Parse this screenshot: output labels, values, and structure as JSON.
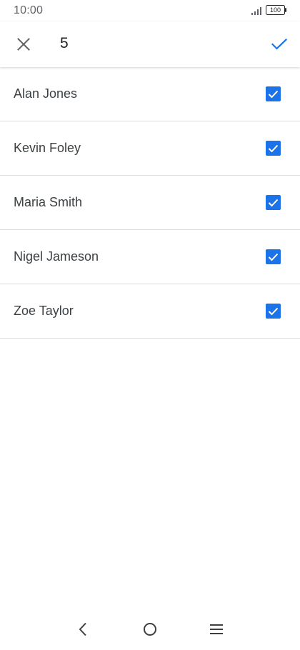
{
  "status_bar": {
    "time": "10:00",
    "battery": "100",
    "icons": [
      "signal-icon",
      "battery-icon"
    ]
  },
  "app_bar": {
    "selected_count": "5",
    "close_icon": "close-icon",
    "confirm_icon": "checkmark-icon"
  },
  "contacts": [
    {
      "name": "Alan Jones",
      "checked": true
    },
    {
      "name": "Kevin Foley",
      "checked": true
    },
    {
      "name": "Maria Smith",
      "checked": true
    },
    {
      "name": "Nigel Jameson",
      "checked": true
    },
    {
      "name": "Zoe Taylor",
      "checked": true
    }
  ],
  "nav_bar": {
    "icons": [
      "back-icon",
      "home-icon",
      "menu-icon"
    ]
  },
  "colors": {
    "accent": "#1a73e8",
    "divider": "#dadce0",
    "text": "#3c4043"
  }
}
